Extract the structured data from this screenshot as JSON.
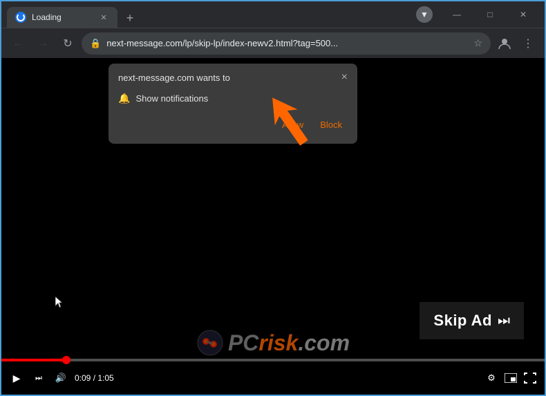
{
  "browser": {
    "tab": {
      "title": "Loading",
      "favicon_label": "loading-favicon"
    },
    "window_controls": {
      "minimize": "—",
      "maximize": "□",
      "close": "✕"
    },
    "new_tab_label": "+",
    "address_bar": {
      "url": "next-message.com/lp/skip-lp/index-newv2.html?tag=500...",
      "lock_icon": "🔒"
    },
    "nav": {
      "back": "←",
      "forward": "→",
      "refresh": "↻"
    }
  },
  "notification_popup": {
    "site_text": "next-message.com wants to",
    "option_label": "Show notifications",
    "allow_label": "Allow",
    "block_label": "Block",
    "close_label": "×"
  },
  "video": {
    "skip_ad_label": "Skip Ad",
    "time_current": "0:09",
    "time_total": "1:05",
    "watermark": "pcrisk.com"
  },
  "arrow": {
    "label": "pointing-up-left"
  }
}
